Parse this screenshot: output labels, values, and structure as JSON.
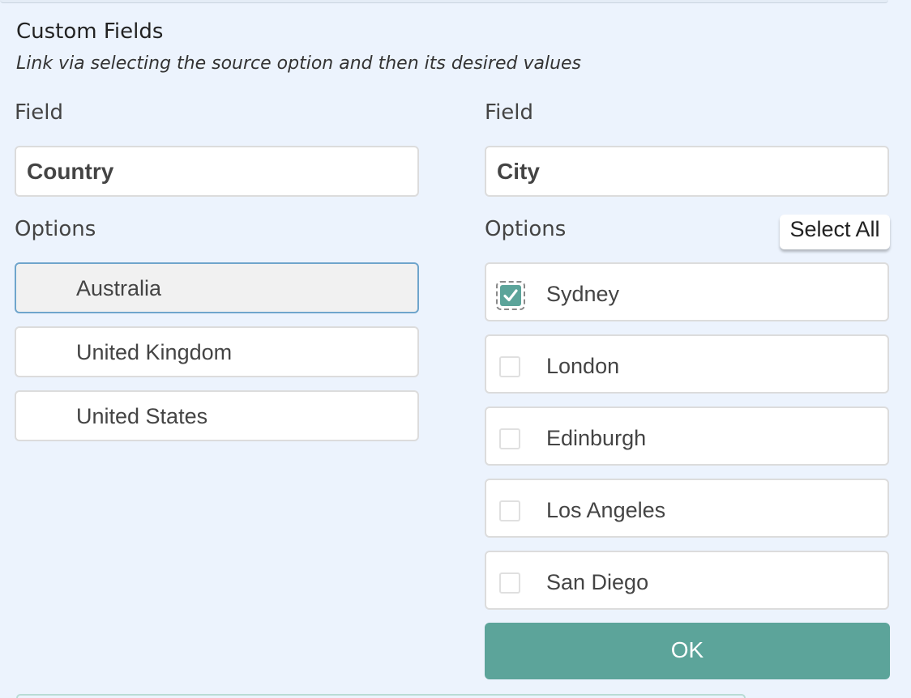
{
  "section": {
    "title": "Custom Fields",
    "subtitle": "Link via selecting the source option and then its desired values"
  },
  "left": {
    "field_label": "Field",
    "field_value": "Country",
    "options_label": "Options",
    "options": [
      {
        "label": "Australia",
        "selected": true
      },
      {
        "label": "United Kingdom",
        "selected": false
      },
      {
        "label": "United States",
        "selected": false
      }
    ]
  },
  "right": {
    "field_label": "Field",
    "field_value": "City",
    "options_label": "Options",
    "select_all_label": "Select All",
    "options": [
      {
        "label": "Sydney",
        "checked": true
      },
      {
        "label": "London",
        "checked": false
      },
      {
        "label": "Edinburgh",
        "checked": false
      },
      {
        "label": "Los Angeles",
        "checked": false
      },
      {
        "label": "San Diego",
        "checked": false
      }
    ]
  },
  "ok_label": "OK",
  "colors": {
    "accent": "#5ca49a",
    "background": "#ecf3fd",
    "selected_border": "#6fa5cc"
  }
}
